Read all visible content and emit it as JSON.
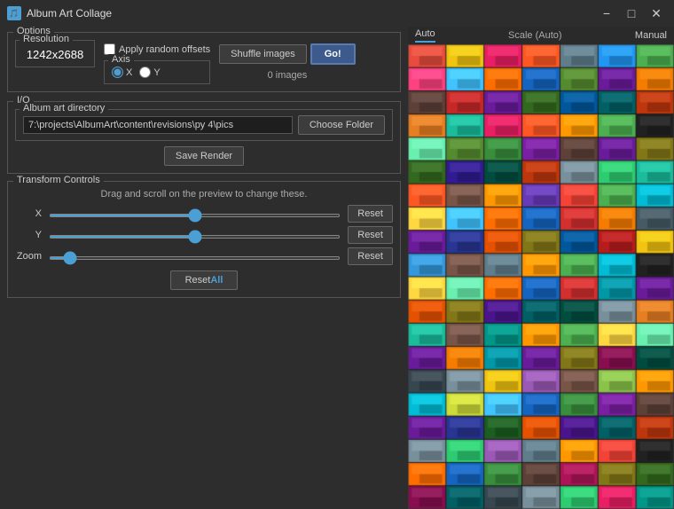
{
  "titleBar": {
    "icon": "🎵",
    "title": "Album Art Collage",
    "minimizeLabel": "−",
    "maximizeLabel": "□",
    "closeLabel": "✕"
  },
  "options": {
    "sectionLabel": "Options",
    "resolution": {
      "legend": "Resolution",
      "value": "1242x2688"
    },
    "applyRandomOffsets": {
      "label": "Apply random offsets",
      "checked": false
    },
    "axis": {
      "legend": "Axis",
      "options": [
        "X",
        "Y"
      ],
      "selected": "X"
    },
    "shuffleButton": "Shuffle images",
    "goButton": "Go!",
    "imagesCount": "0 images"
  },
  "io": {
    "sectionLabel": "I/O",
    "albumArtDirectory": {
      "legend": "Album art directory",
      "value": "7:\\projects\\AlbumArt\\content\\revisions\\py 4\\pics",
      "chooseFolderButton": "Choose Folder"
    },
    "saveRenderButton": "Save Render"
  },
  "transformControls": {
    "sectionLabel": "Transform Controls",
    "hint": "Drag and scroll on the preview to change these.",
    "x": {
      "label": "X",
      "value": 50,
      "resetButton": "Reset"
    },
    "y": {
      "label": "Y",
      "value": 50,
      "resetButton": "Reset"
    },
    "zoom": {
      "label": "Zoom",
      "value": 5,
      "resetButton": "Reset"
    },
    "resetAllButton": "Reset",
    "resetAllHighlight": "All"
  },
  "rightPanel": {
    "scaleLabel": "Scale (Auto)",
    "autoTab": "Auto",
    "manualTab": "Manual"
  }
}
